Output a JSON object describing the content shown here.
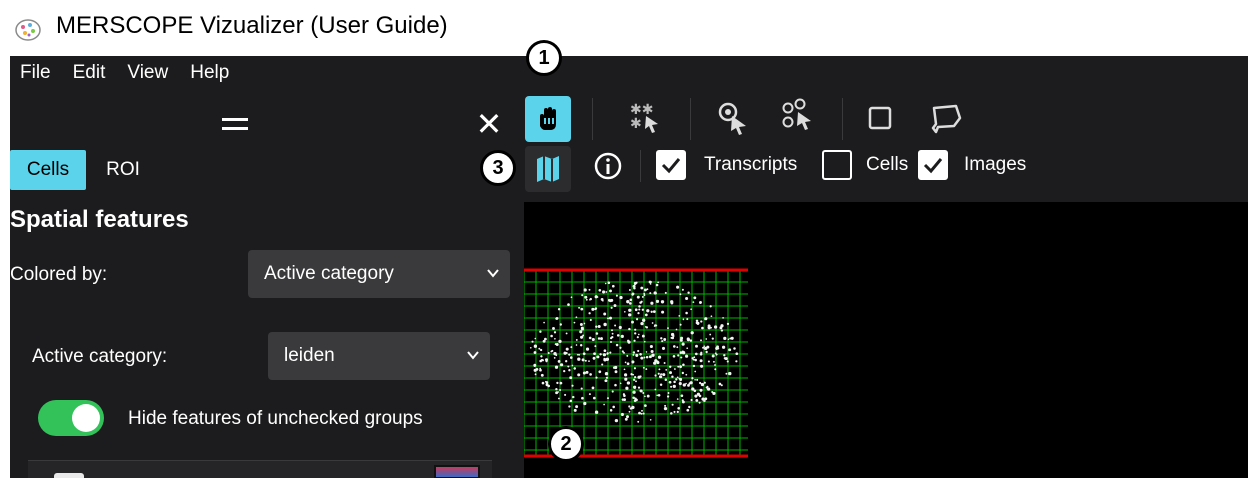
{
  "window": {
    "title": "MERSCOPE Vizualizer (User Guide)"
  },
  "menu": {
    "items": [
      "File",
      "Edit",
      "View",
      "Help"
    ]
  },
  "panel": {
    "tabs": [
      "Cells",
      "ROI"
    ],
    "active_tab": "Cells",
    "section_title": "Spatial features",
    "colored_by_label": "Colored by:",
    "colored_by_value": "Active category",
    "active_category_label": "Active category:",
    "active_category_value": "leiden",
    "hide_toggle_label": "Hide features of unchecked groups",
    "hide_toggle_on": true
  },
  "toolbar": {
    "checkboxes": [
      {
        "label": "Transcripts",
        "checked": true
      },
      {
        "label": "Cells",
        "checked": false
      },
      {
        "label": "Images",
        "checked": true
      }
    ]
  },
  "callouts": {
    "one": "1",
    "two": "2",
    "three": "3"
  },
  "colors": {
    "accent": "#5bd3ea",
    "panel_bg": "#1c1c1e",
    "toggle_on": "#33c25a",
    "grid": "#00b400",
    "boundary": "#e00000"
  }
}
